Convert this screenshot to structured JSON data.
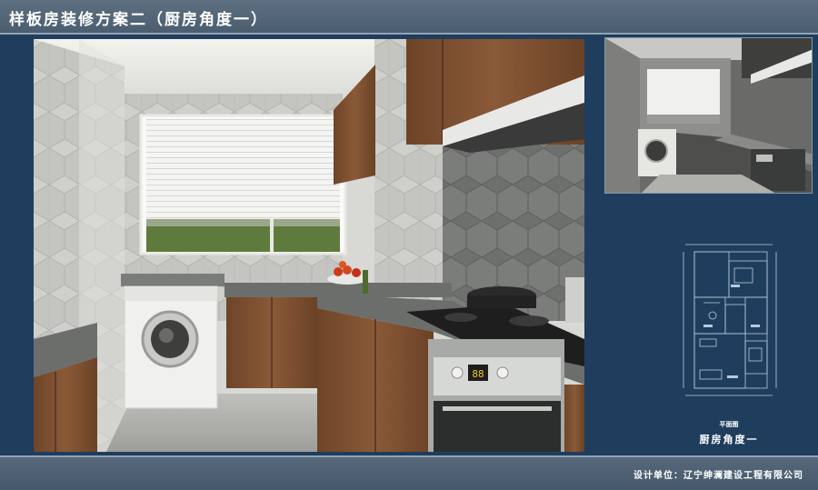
{
  "header": {
    "title": "样板房装修方案二（厨房角度一）"
  },
  "main_render": {
    "oven_display": "88"
  },
  "floorplan": {
    "caption": "平面图",
    "subtitle": "厨房角度一"
  },
  "footer": {
    "company": "设计单位：辽宁绅澜建设工程有限公司"
  },
  "colors": {
    "background": "#1f3e5e",
    "bar": "#4f6275",
    "wood": "#7a4e30"
  }
}
